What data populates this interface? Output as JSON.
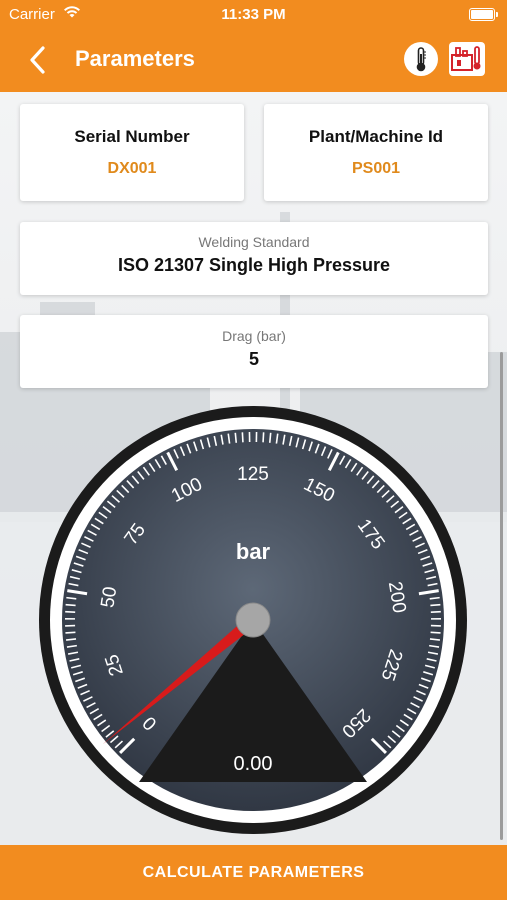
{
  "status_bar": {
    "carrier": "Carrier",
    "time": "11:33 PM"
  },
  "nav": {
    "title": "Parameters",
    "icons": [
      "back-chevron",
      "thermometer",
      "plant-thermometer"
    ]
  },
  "cards": {
    "serial": {
      "label": "Serial Number",
      "value": "DX001"
    },
    "plant": {
      "label": "Plant/Machine Id",
      "value": "PS001"
    },
    "standard": {
      "label": "Welding Standard",
      "value": "ISO 21307 Single High Pressure"
    },
    "drag": {
      "label": "Drag (bar)",
      "value": "5"
    }
  },
  "gauge": {
    "unit": "bar",
    "min": 0,
    "max": 250,
    "major_step": 25,
    "tick_labels": [
      "0",
      "25",
      "50",
      "75",
      "100",
      "125",
      "150",
      "175",
      "200",
      "225",
      "250"
    ],
    "readout": "0.00",
    "needle_value": 5
  },
  "footer": {
    "button": "CALCULATE PARAMETERS"
  },
  "colors": {
    "accent": "#f28c1f",
    "value": "#e08a1c",
    "needle": "#d81b1b",
    "dial": "#4a5565"
  }
}
